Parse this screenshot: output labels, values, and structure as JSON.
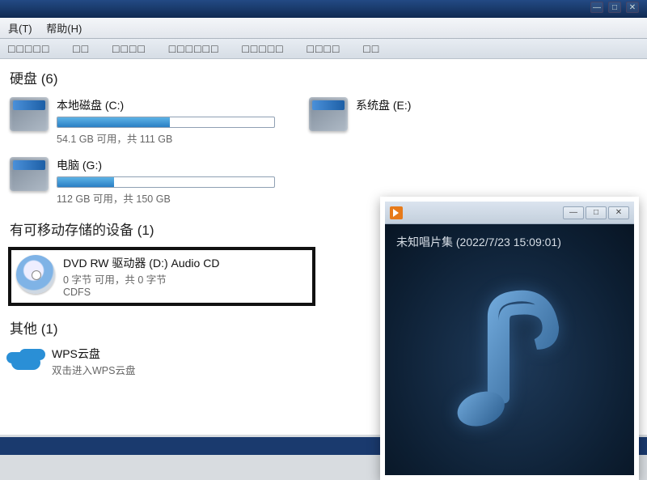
{
  "menu": {
    "tools": "具(T)",
    "help": "帮助(H)"
  },
  "toolbar": [
    "□□□□□",
    "□□",
    "□□□□",
    "□□□□□□",
    "□□□□□",
    "□□□□",
    "□□"
  ],
  "sections": {
    "hdd_header": "硬盘 (6)",
    "removable_header": "有可移动存储的设备 (1)",
    "other_header": "其他 (1)"
  },
  "drives": [
    {
      "label": "本地磁盘 (C:)",
      "sub": "54.1 GB 可用，共 111 GB",
      "fill_pct": 52
    },
    {
      "label": "系统盘 (E:)",
      "sub": "",
      "fill_pct": 0
    },
    {
      "label": "电脑 (G:)",
      "sub": "112 GB 可用，共 150 GB",
      "fill_pct": 26
    }
  ],
  "cd": {
    "label": "DVD RW 驱动器 (D:) Audio CD",
    "line2": "0 字节 可用，共 0 字节",
    "line3": "CDFS"
  },
  "wps": {
    "title": "WPS云盘",
    "sub": "双击进入WPS云盘"
  },
  "player": {
    "album": "未知唱片集 (2022/7/23 15:09:01)",
    "min": "—",
    "max": "□",
    "close": "✕"
  },
  "colors": {
    "accent": "#2a7fc4"
  }
}
